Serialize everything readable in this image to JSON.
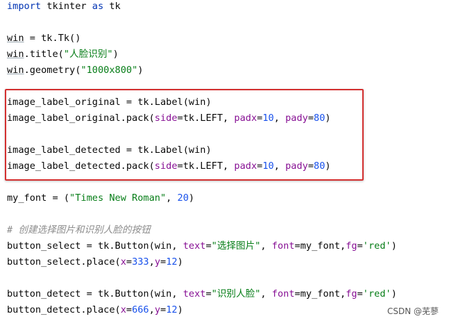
{
  "code": {
    "l1": {
      "kw": "import",
      "mid": " tkinter ",
      "kw2": "as",
      "end": " tk"
    },
    "l3": {
      "ident": "win",
      "rest": " = tk.Tk()"
    },
    "l4": {
      "ident": "win",
      "a": ".title(",
      "str": "\"人脸识别\"",
      "b": ")"
    },
    "l5": {
      "ident": "win",
      "a": ".geometry(",
      "str": "\"1000x800\"",
      "b": ")"
    },
    "l7": {
      "text": "image_label_original = tk.Label(win)"
    },
    "l8": {
      "a": "image_label_original.pack(",
      "p1": "side",
      "b": "=tk.LEFT, ",
      "p2": "padx",
      "c": "=",
      "n1": "10",
      "d": ", ",
      "p3": "pady",
      "e": "=",
      "n2": "80",
      "f": ")"
    },
    "l10": {
      "text": "image_label_detected = tk.Label(win)"
    },
    "l11": {
      "a": "image_label_detected.pack(",
      "p1": "side",
      "b": "=tk.LEFT, ",
      "p2": "padx",
      "c": "=",
      "n1": "10",
      "d": ", ",
      "p3": "pady",
      "e": "=",
      "n2": "80",
      "f": ")"
    },
    "l13": {
      "a": "my_font = (",
      "str": "\"Times New Roman\"",
      "b": ", ",
      "n": "20",
      "c": ")"
    },
    "l15": {
      "hash": "# ",
      "comment": "创建选择图片和识别人脸的按钮"
    },
    "l16": {
      "a": "button_select = tk.Button(win, ",
      "p1": "text",
      "b": "=",
      "s1": "\"选择图片\"",
      "c": ", ",
      "p2": "font",
      "d": "=my_font,",
      "p3": "fg",
      "e": "=",
      "s2": "'red'",
      "f": ")"
    },
    "l17": {
      "a": "button_select.place(",
      "p1": "x",
      "b": "=",
      "n1": "333",
      "c": ",",
      "p2": "y",
      "d": "=",
      "n2": "12",
      "e": ")"
    },
    "l19": {
      "a": "button_detect = tk.Button(win, ",
      "p1": "text",
      "b": "=",
      "s1": "\"识别人脸\"",
      "c": ", ",
      "p2": "font",
      "d": "=my_font,",
      "p3": "fg",
      "e": "=",
      "s2": "'red'",
      "f": ")"
    },
    "l20": {
      "a": "button_detect.place(",
      "p1": "x",
      "b": "=",
      "n1": "666",
      "c": ",",
      "p2": "y",
      "d": "=",
      "n2": "12",
      "e": ")"
    }
  },
  "watermark": "CSDN @芜蓼",
  "colors": {
    "keyword": "#0033b3",
    "string": "#067d17",
    "number": "#1750eb",
    "parameter": "#871094",
    "comment": "#8c8c8c",
    "highlight_border": "#d32f2f"
  }
}
